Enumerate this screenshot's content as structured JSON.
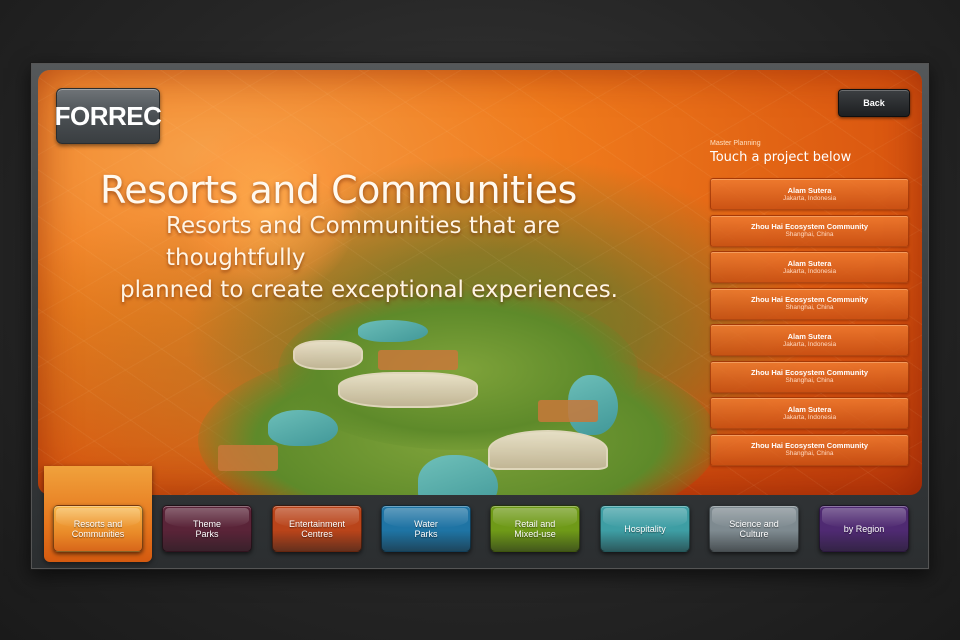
{
  "app": {
    "logo_text": "FORREC"
  },
  "header": {
    "back_label": "Back"
  },
  "hero": {
    "title": "Resorts and Communities",
    "subtitle_line1": "Resorts and Communities that are thoughtfully",
    "subtitle_line2": "planned to create exceptional experiences."
  },
  "panel": {
    "kicker": "Master Planning",
    "title": "Touch a project below",
    "projects": [
      {
        "name": "Alam Sutera",
        "location": "Jakarta, Indonesia"
      },
      {
        "name": "Zhou Hai Ecosystem Community",
        "location": "Shanghai, China"
      },
      {
        "name": "Alam Sutera",
        "location": "Jakarta, Indonesia"
      },
      {
        "name": "Zhou Hai Ecosystem Community",
        "location": "Shanghai, China"
      },
      {
        "name": "Alam Sutera",
        "location": "Jakarta, Indonesia"
      },
      {
        "name": "Zhou Hai Ecosystem Community",
        "location": "Shanghai, China"
      },
      {
        "name": "Alam Sutera",
        "location": "Jakarta, Indonesia"
      },
      {
        "name": "Zhou Hai Ecosystem Community",
        "location": "Shanghai, China"
      }
    ]
  },
  "categories": [
    {
      "line1": "Resorts and",
      "line2": "Communities",
      "color": "#e98a28",
      "active": true
    },
    {
      "line1": "Theme",
      "line2": "Parks",
      "color": "#5a2438"
    },
    {
      "line1": "Entertainment",
      "line2": "Centres",
      "color": "#b9441a"
    },
    {
      "line1": "Water",
      "line2": "Parks",
      "color": "#1f74a4"
    },
    {
      "line1": "Retail and",
      "line2": "Mixed-use",
      "color": "#6f9a18"
    },
    {
      "line1": "Hospitality",
      "line2": "",
      "color": "#3e9ea4"
    },
    {
      "line1": "Science and",
      "line2": "Culture",
      "color": "#7e8a90"
    },
    {
      "line1": "by Region",
      "line2": "",
      "color": "#4f2a72"
    }
  ]
}
